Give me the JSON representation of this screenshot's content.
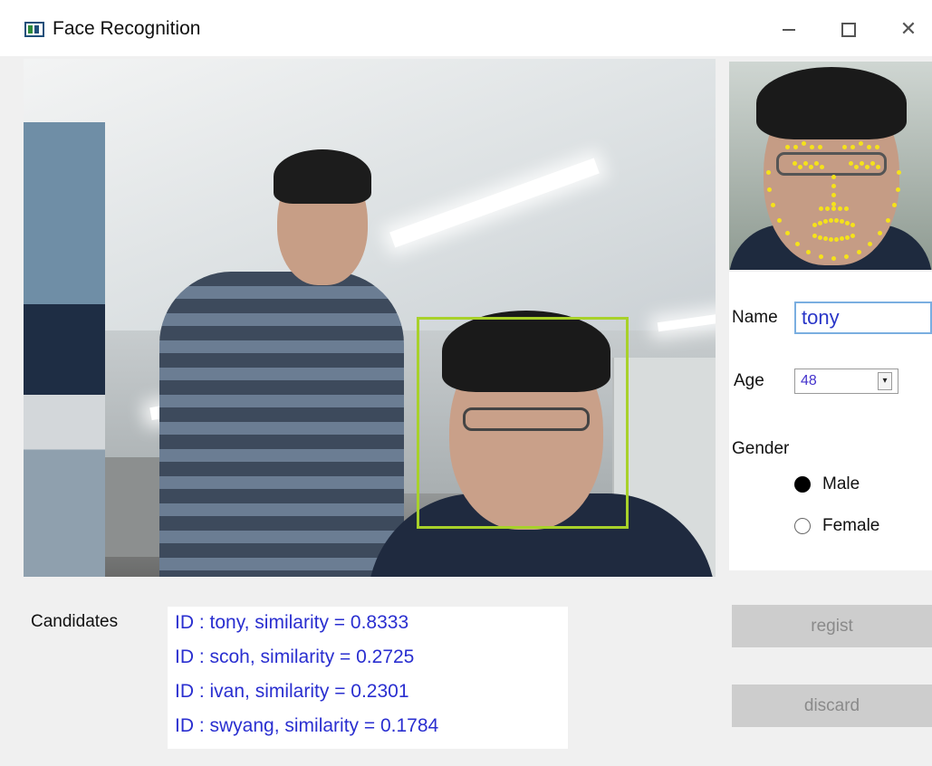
{
  "window": {
    "title": "Face Recognition",
    "minimize_label": "–",
    "maximize_label": "□",
    "close_label": "✕"
  },
  "form": {
    "name_label": "Name",
    "name_value": "tony",
    "age_label": "Age",
    "age_value": "48",
    "gender_label": "Gender",
    "gender_options": [
      {
        "label": "Male",
        "selected": true
      },
      {
        "label": "Female",
        "selected": false
      }
    ]
  },
  "candidates": {
    "label": "Candidates",
    "items": [
      "ID : tony, similarity = 0.8333",
      "ID : scoh, similarity = 0.2725",
      "ID : ivan, similarity = 0.2301",
      "ID : swyang, similarity = 0.1784"
    ]
  },
  "buttons": {
    "regist_label": "regist",
    "discard_label": "discard"
  },
  "colors": {
    "face_box": "#a8d12a",
    "landmarks": "#f5e21a",
    "candidate_text": "#2a2fd0"
  }
}
